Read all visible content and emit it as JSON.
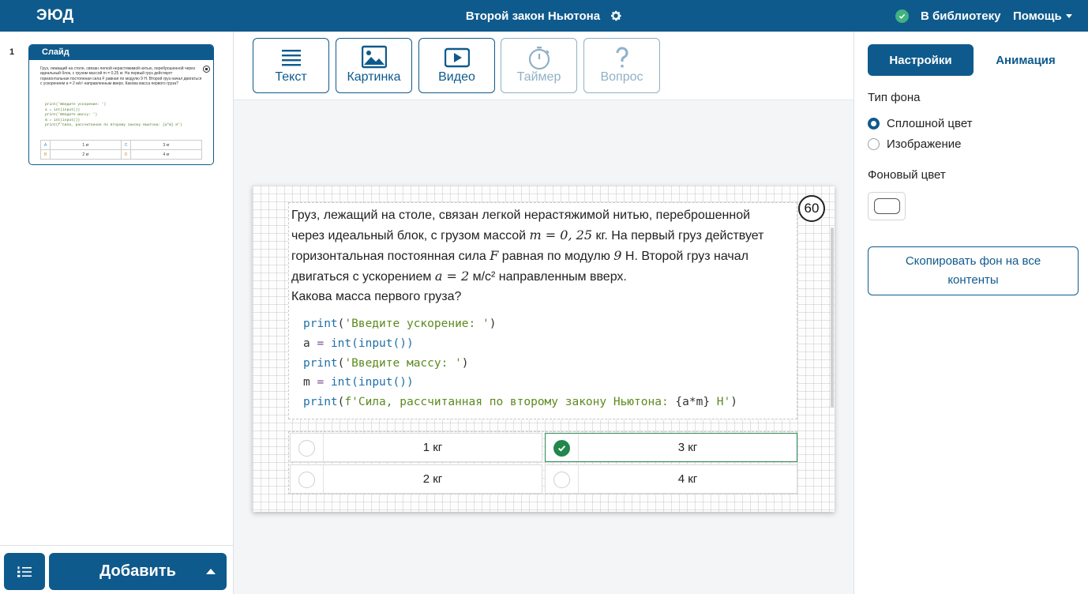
{
  "header": {
    "logo": "ЭЮД",
    "title": "Второй закон Ньютона",
    "library_label": "В библиотеку",
    "help_label": "Помощь"
  },
  "sidebar": {
    "slides": [
      {
        "number": "1",
        "title": "Слайд",
        "preview_text": "Груз, лежащий на столе, связан легкой нерастяжимой нитью, переброшенной через идеальный блок, с грузом массой m = 0,25 кг. На первый груз действует горизонтальная постоянная сила F равная по модулю 9 Н. Второй груз начал двигаться с ускорением a = 2 м/с² направленным вверх. Какова масса первого груза?",
        "preview_code": [
          "print('Введите ускорение: ')",
          "a = int(input())",
          "print('Введите массу: ')",
          "m = int(input())",
          "print(f'Сила, рассчитанная по второму закону Ньютона: {a*m} Н')"
        ],
        "preview_answers": [
          {
            "label": "A",
            "text": "1 кг"
          },
          {
            "label": "C",
            "text": "3 кг"
          },
          {
            "label": "B",
            "text": "2 кг"
          },
          {
            "label": "D",
            "text": "4 кг"
          }
        ]
      }
    ],
    "add_label": "Добавить"
  },
  "toolbar": {
    "tools": [
      {
        "label": "Текст",
        "icon": "text-lines-icon",
        "enabled": true
      },
      {
        "label": "Картинка",
        "icon": "image-icon",
        "enabled": true
      },
      {
        "label": "Видео",
        "icon": "video-play-icon",
        "enabled": true
      },
      {
        "label": "Таймер",
        "icon": "stopwatch-icon",
        "enabled": false
      },
      {
        "label": "Вопрос",
        "icon": "question-mark-icon",
        "enabled": false
      }
    ]
  },
  "slide": {
    "timer": "60",
    "question": {
      "line1": "Груз, лежащий на столе, связан легкой нерастяжимой нитью, переброшенной",
      "line2_pre": "через идеальный блок, с грузом массой ",
      "mass_math": "m = 0, 25",
      "line2_post": " кг. На первый груз действует",
      "line3_pre": "горизонтальная постоянная сила ",
      "force_var": "F",
      "line3_mid": " равная по модулю ",
      "force_val": "9",
      "line3_post": " Н. Второй груз начал",
      "line4_pre": "двигаться с ускорением ",
      "accel_math": "a = 2",
      "line4_post": " м/с² направленным вверх.",
      "line5": "Какова масса первого груза?"
    },
    "code": {
      "l1_fn": "print",
      "l1_str": "'Введите ускорение: '",
      "l2_var": "a",
      "l2_call": "int(input())",
      "l3_fn": "print",
      "l3_str": "'Введите массу: '",
      "l4_var": "m",
      "l4_call": "int(input())",
      "l5_fn": "print",
      "l5_str": "f'Сила, рассчитанная по второму закону Ньютона: ",
      "l5_expr": "{a*m}",
      "l5_end": " Н'"
    },
    "answers": [
      {
        "text": "1 кг",
        "correct": false
      },
      {
        "text": "3 кг",
        "correct": true
      },
      {
        "text": "2 кг",
        "correct": false
      },
      {
        "text": "4 кг",
        "correct": false
      }
    ]
  },
  "settings": {
    "tabs": {
      "settings": "Настройки",
      "animation": "Анимация"
    },
    "bg_type_label": "Тип фона",
    "bg_options": [
      {
        "label": "Сплошной цвет",
        "selected": true
      },
      {
        "label": "Изображение",
        "selected": false
      }
    ],
    "bg_color_label": "Фоновый цвет",
    "bg_color_value": "#ffffff",
    "copy_label_line1": "Скопировать фон на все",
    "copy_label_line2": "контенты"
  },
  "colors": {
    "brand": "#0f5a8c",
    "success": "#21874a",
    "status_ok": "#3fb27f"
  }
}
